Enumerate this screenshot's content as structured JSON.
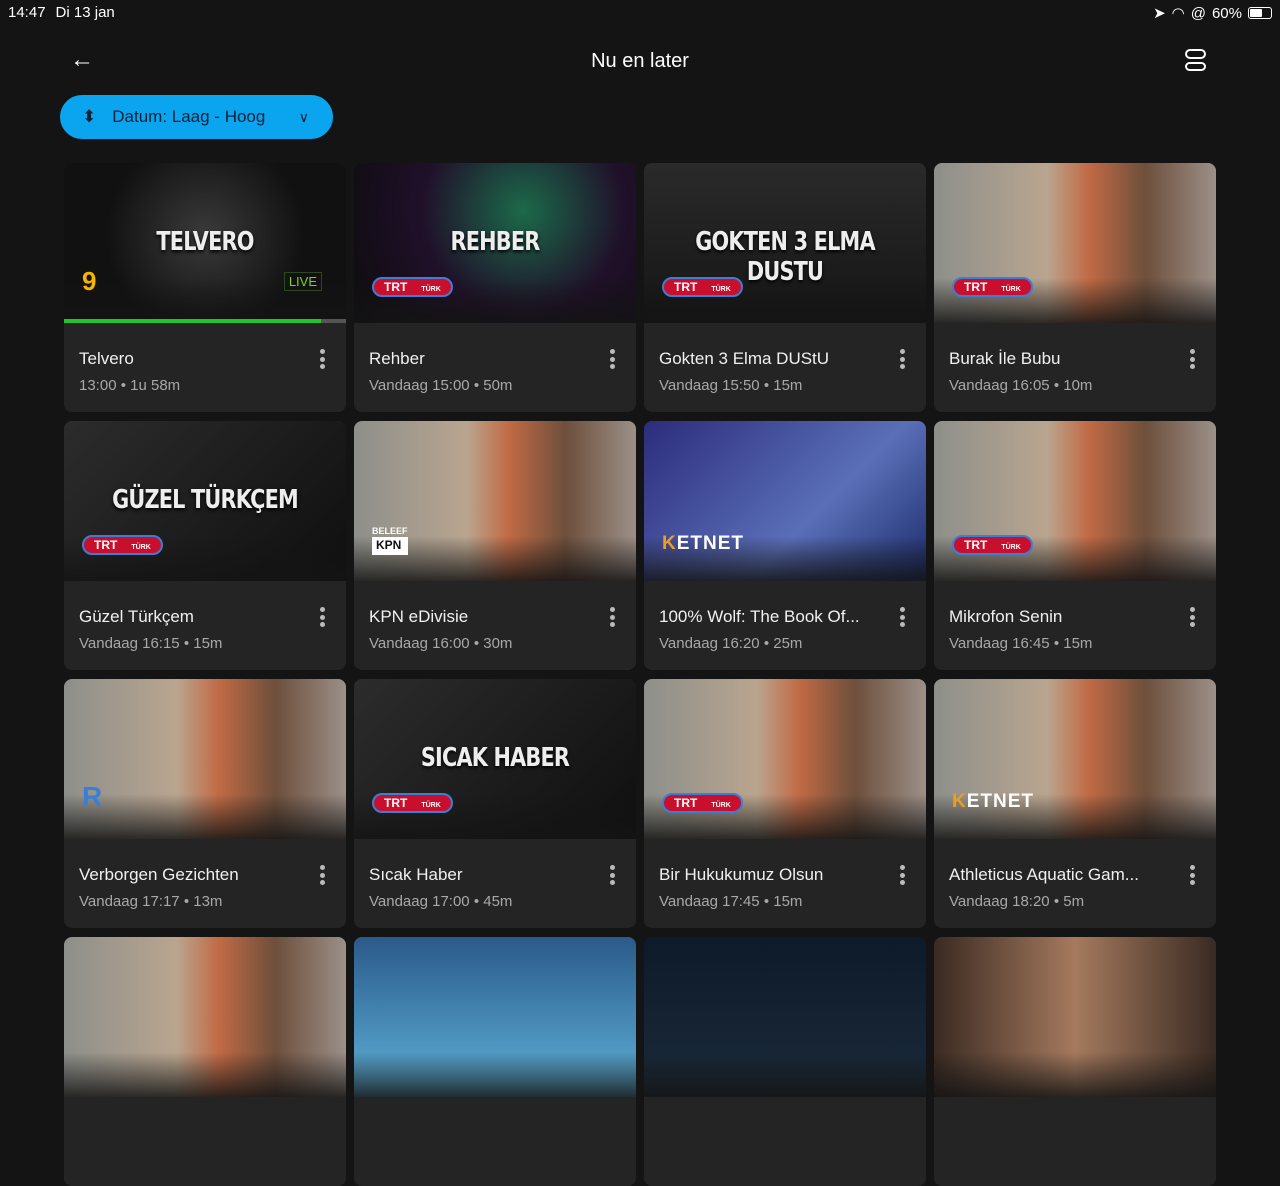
{
  "status": {
    "time": "14:47",
    "date": "Di 13 jan",
    "battery": "60%",
    "battery_level": 60
  },
  "header": {
    "title": "Nu en later",
    "back_icon": "arrow-left-icon",
    "layout_icon": "list-layout-icon"
  },
  "sort": {
    "label": "Datum: Laag - Hoog"
  },
  "cards": [
    {
      "name": "Telvero",
      "meta": "13:00 • 1u 58m",
      "thumb_title": "TELVERO",
      "logo": "SBS 9",
      "live": "LIVE",
      "progress": 0.91,
      "style": "t0"
    },
    {
      "name": "Rehber",
      "meta": "Vandaag 15:00 • 50m",
      "thumb_title": "REHBER",
      "logo": "TRT",
      "style": "t1"
    },
    {
      "name": "Gokten 3 Elma DUStU",
      "meta": "Vandaag 15:50 • 15m",
      "thumb_title": "GOKTEN 3 ELMA DUSTU",
      "logo": "TRT",
      "style": "t2"
    },
    {
      "name": "Burak İle Bubu",
      "meta": "Vandaag 16:05 • 10m",
      "thumb_title": "",
      "logo": "TRT",
      "style": "tc"
    },
    {
      "name": "Güzel Türkçem",
      "meta": "Vandaag 16:15 • 15m",
      "thumb_title": "GÜZEL TÜRKÇEM",
      "logo": "TRT",
      "style": "t4"
    },
    {
      "name": "KPN eDivisie",
      "meta": "Vandaag 16:00 • 30m",
      "thumb_title": "",
      "logo": "KPN",
      "style": "tc"
    },
    {
      "name": "100% Wolf: The Book Of...",
      "meta": "Vandaag 16:20 • 25m",
      "thumb_title": "",
      "logo": "KETNET",
      "style": "t6"
    },
    {
      "name": "Mikrofon Senin",
      "meta": "Vandaag 16:45 • 15m",
      "thumb_title": "",
      "logo": "TRT",
      "style": "tc"
    },
    {
      "name": "Verborgen Gezichten",
      "meta": "Vandaag 17:17 • 13m",
      "thumb_title": "",
      "logo": "R",
      "style": "tc"
    },
    {
      "name": "Sıcak Haber",
      "meta": "Vandaag 17:00 • 45m",
      "thumb_title": "SICAK HABER",
      "logo": "TRT",
      "style": "t4"
    },
    {
      "name": "Bir Hukukumuz Olsun",
      "meta": "Vandaag 17:45 • 15m",
      "thumb_title": "",
      "logo": "TRT",
      "style": "tc"
    },
    {
      "name": "Athleticus Aquatic Gam...",
      "meta": "Vandaag 18:20 • 5m",
      "thumb_title": "",
      "logo": "KETNET",
      "style": "tc"
    },
    {
      "name": "",
      "meta": "",
      "thumb_title": "",
      "logo": "",
      "style": "tc"
    },
    {
      "name": "",
      "meta": "",
      "thumb_title": "",
      "logo": "",
      "style": "t12"
    },
    {
      "name": "",
      "meta": "",
      "thumb_title": "",
      "logo": "",
      "style": "t13"
    },
    {
      "name": "",
      "meta": "",
      "thumb_title": "",
      "logo": "",
      "style": "t15"
    }
  ],
  "logos": {
    "trt": "TRT",
    "trt_sub": "TÜRK",
    "ketnet": "KETNET",
    "kpn_top": "BELEEF",
    "kpn": "KPN",
    "sbs": "9"
  }
}
